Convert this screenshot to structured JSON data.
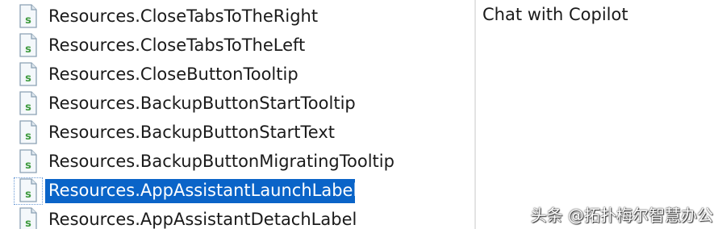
{
  "resource_list": {
    "items": [
      {
        "label": "Resources.CloseTabsToTheRight",
        "icon": "string-resource-icon",
        "selected": false
      },
      {
        "label": "Resources.CloseTabsToTheLeft",
        "icon": "string-resource-icon",
        "selected": false
      },
      {
        "label": "Resources.CloseButtonTooltip",
        "icon": "string-resource-icon",
        "selected": false
      },
      {
        "label": "Resources.BackupButtonStartTooltip",
        "icon": "string-resource-icon",
        "selected": false
      },
      {
        "label": "Resources.BackupButtonStartText",
        "icon": "string-resource-icon",
        "selected": false
      },
      {
        "label": "Resources.BackupButtonMigratingTooltip",
        "icon": "string-resource-icon",
        "selected": false
      },
      {
        "label": "Resources.AppAssistantLaunchLabel",
        "icon": "string-resource-icon",
        "selected": true
      },
      {
        "label": "Resources.AppAssistantDetachLabel",
        "icon": "string-resource-icon",
        "selected": false
      }
    ]
  },
  "value_pane": {
    "text": "Chat with Copilot"
  },
  "watermark": {
    "text": "头条 @拓扑梅尔智慧办公"
  },
  "colors": {
    "selection": "#0a64c8",
    "icon_green": "#3f9b3f",
    "divider": "#e3e3e3"
  }
}
